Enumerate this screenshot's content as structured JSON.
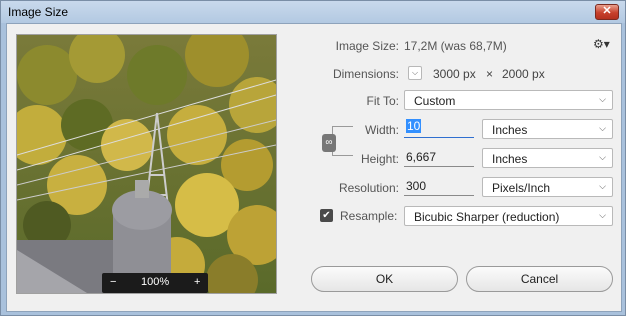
{
  "window": {
    "title": "Image Size",
    "close_glyph": "✕"
  },
  "info": {
    "image_size_label": "Image Size:",
    "image_size_value": "17,2M (was 68,7M)",
    "dimensions_label": "Dimensions:",
    "dim_width": "3000 px",
    "dim_sep": "×",
    "dim_height": "2000 px",
    "gear_glyph": "⚙▾"
  },
  "fit_to": {
    "label": "Fit To:",
    "value": "Custom"
  },
  "width": {
    "label": "Width:",
    "value": "10",
    "unit": "Inches"
  },
  "height": {
    "label": "Height:",
    "value": "6,667",
    "unit": "Inches"
  },
  "resolution": {
    "label": "Resolution:",
    "value": "300",
    "unit": "Pixels/Inch"
  },
  "resample": {
    "label": "Resample:",
    "checked": true,
    "value": "Bicubic Sharper (reduction)"
  },
  "preview": {
    "zoom": "100%",
    "zoom_out": "−",
    "zoom_in": "+"
  },
  "buttons": {
    "ok": "OK",
    "cancel": "Cancel"
  },
  "icons": {
    "chevron": "⌵",
    "check": "✔",
    "link": "🔗"
  },
  "colors": {
    "accent": "#3390ff",
    "title_bar": "#b3c9e2",
    "close": "#c7402c"
  }
}
